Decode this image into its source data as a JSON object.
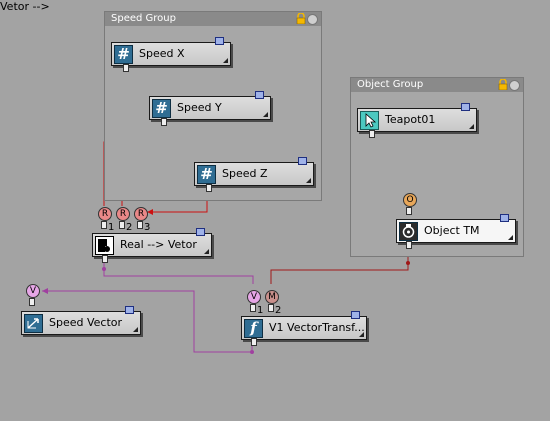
{
  "groups": {
    "speed": {
      "title": "Speed Group"
    },
    "object": {
      "title": "Object Group"
    }
  },
  "nodes": {
    "speed_x": {
      "label": "Speed X",
      "icon": "hash-icon"
    },
    "speed_y": {
      "label": "Speed Y",
      "icon": "hash-icon"
    },
    "speed_z": {
      "label": "Speed Z",
      "icon": "hash-icon"
    },
    "teapot": {
      "label": "Teapot01",
      "icon": "pick-cursor-icon"
    },
    "real_vector": {
      "label": "Real --> Vetor",
      "icon": "converter-icon"
    },
    "object_tm": {
      "label": "Object TM",
      "icon": "transform-icon"
    },
    "speed_vector": {
      "label": "Speed Vector",
      "icon": "vector-icon"
    },
    "v1_transform": {
      "label": "V1 VectorTransf...",
      "icon": "function-icon"
    }
  },
  "ports": {
    "real_vector_inputs": [
      {
        "letter": "R",
        "number": "1"
      },
      {
        "letter": "R",
        "number": "2"
      },
      {
        "letter": "R",
        "number": "3"
      }
    ],
    "object_tm_input": {
      "letter": "O"
    },
    "speed_vector_input": {
      "letter": "V"
    },
    "v1_transform_inputs": [
      {
        "letter": "V",
        "number": "1"
      },
      {
        "letter": "M",
        "number": "2"
      }
    ]
  },
  "colors": {
    "canvas": "#a3a3a3",
    "wire_real": "#cc1010",
    "wire_object": "#e88a10",
    "wire_vector": "#a040a0",
    "wire_matrix": "#a01818",
    "node_icon": "#2f6d93"
  }
}
